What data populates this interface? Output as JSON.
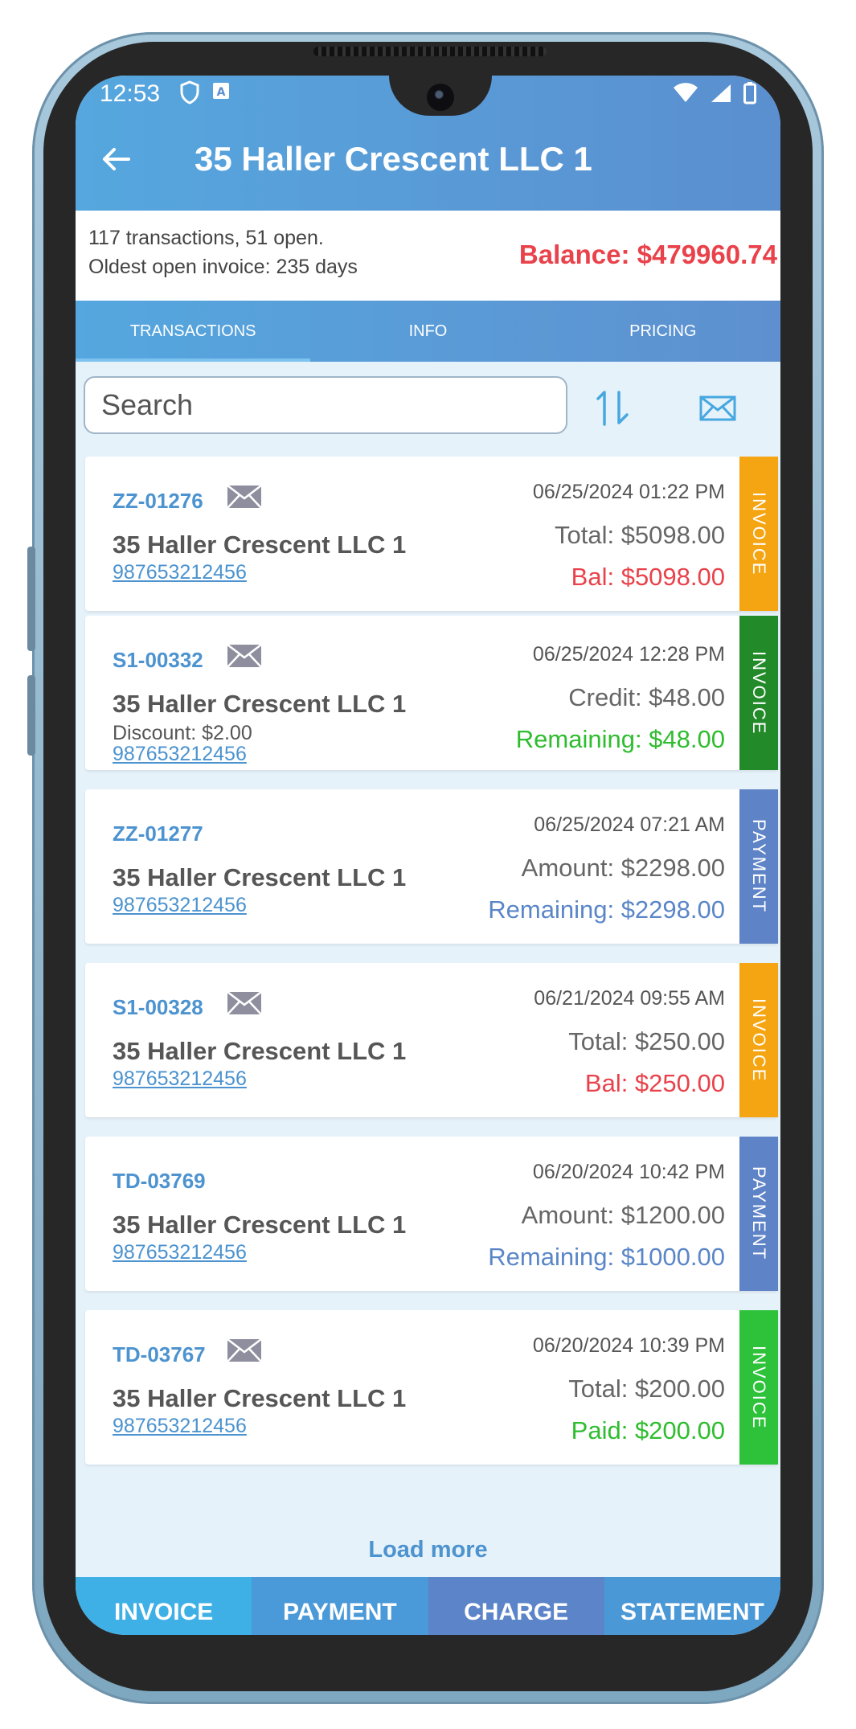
{
  "status": {
    "time": "12:53"
  },
  "header": {
    "title": "35 Haller Crescent LLC 1"
  },
  "summary": {
    "transactions_text": "117 transactions, 51 open.",
    "oldest_text": "Oldest open invoice: 235 days",
    "balance": "Balance: $479960.74"
  },
  "tabs": [
    {
      "label": "TRANSACTIONS",
      "active": true
    },
    {
      "label": "INFO",
      "active": false
    },
    {
      "label": "PRICING",
      "active": false
    }
  ],
  "search": {
    "placeholder": "Search"
  },
  "transactions": [
    {
      "number": "ZZ-01276",
      "emailed": true,
      "customer": "35 Haller Crescent LLC 1",
      "discount": "",
      "account": "987653212456",
      "date": "06/25/2024 01:22 PM",
      "line2": "Total: $5098.00",
      "line3": "Bal: $5098.00",
      "line3_color": "#e9424b",
      "type": "INVOICE",
      "type_color": "#f5a412"
    },
    {
      "number": "S1-00332",
      "emailed": true,
      "customer": "35 Haller Crescent LLC 1",
      "discount": "Discount: $2.00",
      "account": "987653212456",
      "date": "06/25/2024 12:28 PM",
      "line2": "Credit: $48.00",
      "line3": "Remaining: $48.00",
      "line3_color": "#2fbd2f",
      "type": "INVOICE",
      "type_color": "#238a2a"
    },
    {
      "number": "ZZ-01277",
      "emailed": false,
      "customer": "35 Haller Crescent LLC 1",
      "discount": "",
      "account": "987653212456",
      "date": "06/25/2024 07:21 AM",
      "line2": "Amount: $2298.00",
      "line3": "Remaining: $2298.00",
      "line3_color": "#5a86c8",
      "type": "PAYMENT",
      "type_color": "#5e83c6"
    },
    {
      "number": "S1-00328",
      "emailed": true,
      "customer": "35 Haller Crescent LLC 1",
      "discount": "",
      "account": "987653212456",
      "date": "06/21/2024 09:55 AM",
      "line2": "Total: $250.00",
      "line3": "Bal: $250.00",
      "line3_color": "#e9424b",
      "type": "INVOICE",
      "type_color": "#f5a412"
    },
    {
      "number": "TD-03769",
      "emailed": false,
      "customer": "35 Haller Crescent LLC 1",
      "discount": "",
      "account": "987653212456",
      "date": "06/20/2024 10:42 PM",
      "line2": "Amount: $1200.00",
      "line3": "Remaining: $1000.00",
      "line3_color": "#5a86c8",
      "type": "PAYMENT",
      "type_color": "#5e83c6"
    },
    {
      "number": "TD-03767",
      "emailed": true,
      "customer": "35 Haller Crescent LLC 1",
      "discount": "",
      "account": "987653212456",
      "date": "06/20/2024 10:39 PM",
      "line2": "Total: $200.00",
      "line3": "Paid: $200.00",
      "line3_color": "#2fbd2f",
      "type": "INVOICE",
      "type_color": "#2ec23a"
    }
  ],
  "load_more": "Load more",
  "bottom_nav": [
    {
      "label": "INVOICE",
      "color": "#3fb0e6"
    },
    {
      "label": "PAYMENT",
      "color": "#4a99d8"
    },
    {
      "label": "CHARGE",
      "color": "#5b84c9"
    },
    {
      "label": "STATEMENT",
      "color": "#4b98d7"
    }
  ]
}
